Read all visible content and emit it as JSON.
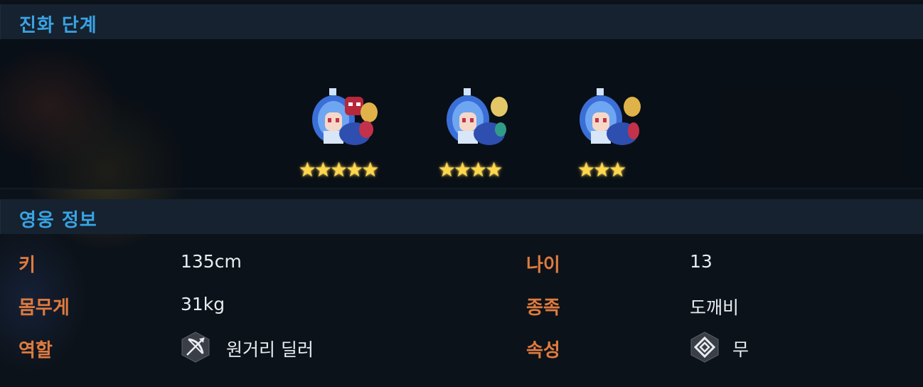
{
  "sections": {
    "evolution_title": "진화 단계",
    "hero_info_title": "영웅 정보"
  },
  "evolution": {
    "stages": [
      {
        "stars": "★★★★★",
        "star_count": 5
      },
      {
        "stars": "★★★★",
        "star_count": 4
      },
      {
        "stars": "★★★",
        "star_count": 3
      }
    ]
  },
  "info": {
    "height_label": "키",
    "height_value": "135cm",
    "weight_label": "몸무게",
    "weight_value": "31kg",
    "role_label": "역할",
    "role_value": "원거리 딜러",
    "role_icon": "bow-arrow-icon",
    "age_label": "나이",
    "age_value": "13",
    "race_label": "종족",
    "race_value": "도깨비",
    "attribute_label": "속성",
    "attribute_value": "무",
    "attribute_icon": "neutral-element-icon"
  },
  "colors": {
    "header_text": "#39a3e3",
    "label_text": "#e07b3e",
    "star": "#ffd74a"
  }
}
